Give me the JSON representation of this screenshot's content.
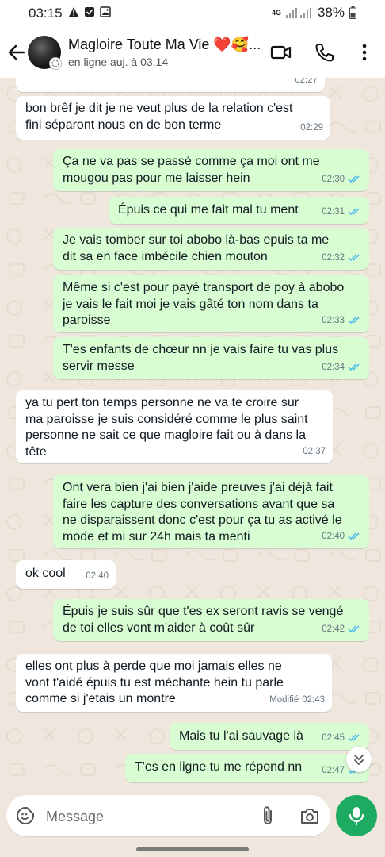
{
  "status_bar": {
    "time": "03:15",
    "network": "4G",
    "battery": "38%"
  },
  "header": {
    "contact_name": "Magloire Toute Ma Vie ❤️🥰...",
    "contact_status": "en ligne auj. à 03:14"
  },
  "messages": [
    {
      "dir": "in",
      "text": "",
      "time": "02:27",
      "edited": ""
    },
    {
      "dir": "in",
      "text": "bon brêf je dit je ne veut plus de la relation c'est\nfini séparont nous en de bon terme",
      "time": "02:29",
      "edited": ""
    },
    {
      "dir": "out",
      "text": "Ça ne va pas se passé comme ça moi ont me\nmougou pas pour me laisser hein",
      "time": "02:30",
      "edited": ""
    },
    {
      "dir": "out",
      "text": "Épuis ce qui me fait mal tu ment",
      "time": "02:31",
      "edited": ""
    },
    {
      "dir": "out",
      "text": "Je vais tomber sur toi abobo là-bas epuis ta me\ndit sa en face imbécile chien mouton",
      "time": "02:32",
      "edited": ""
    },
    {
      "dir": "out",
      "text": "Même si c'est pour payé transport de poy à abobo\nje vais le fait moi je vais gâté ton nom dans ta\nparoisse",
      "time": "02:33",
      "edited": ""
    },
    {
      "dir": "out",
      "text": "T'es enfants de chœur nn je vais faire tu vas plus\nservir messe",
      "time": "02:34",
      "edited": ""
    },
    {
      "dir": "in",
      "text": "ya tu pert ton temps personne ne va te croire sur\nma paroisse je suis considéré comme le plus saint\npersonne ne sait ce que magloire fait ou à dans la\ntête",
      "time": "02:37",
      "edited": ""
    },
    {
      "dir": "out",
      "text": "Ont vera bien j'ai bien j'aide preuves j'ai déjà fait\nfaire les capture des conversations avant que sa\nne disparaissent donc c'est pour ça tu as activé le\nmode et mi sur 24h mais ta menti",
      "time": "02:40",
      "edited": ""
    },
    {
      "dir": "in",
      "text": "ok cool",
      "time": "02:40",
      "edited": ""
    },
    {
      "dir": "out",
      "text": "Épuis je suis sûr que t'es ex seront ravis se vengé\nde toi elles vont m'aider à coût sûr",
      "time": "02:42",
      "edited": ""
    },
    {
      "dir": "in",
      "text": "elles ont plus à perde que moi jamais elles ne\nvont t'aidé épuis tu est méchante hein tu parle\ncomme si j'etais un montre",
      "time": "02:43",
      "edited": "Modifié"
    },
    {
      "dir": "out",
      "text": "Mais tu l'ai sauvage là",
      "time": "02:45",
      "edited": ""
    },
    {
      "dir": "out",
      "text": "T'es en ligne tu me répond nn",
      "time": "02:47",
      "edited": ""
    }
  ],
  "composer": {
    "placeholder": "Message"
  },
  "colors": {
    "incoming": "#ffffff",
    "outgoing": "#d9fdd3",
    "read_ticks": "#53bdeb",
    "accent": "#1daa61"
  }
}
